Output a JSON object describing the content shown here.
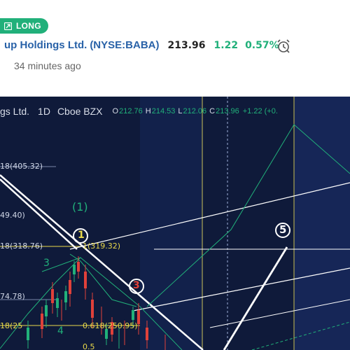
{
  "header": {
    "badge_label": "LONG",
    "company_partial": "up Holdings Ltd.",
    "ticker": "(NYSE:BABA)",
    "price": "213.96",
    "change": "1.22",
    "change_pct": "0.57%",
    "time_ago": "34 minutes ago"
  },
  "chart": {
    "symbol_partial": "gs Ltd.",
    "timeframe": "1D",
    "exchange": "Cboe BZX",
    "ohlc": [
      {
        "k": "O",
        "v": "212.76"
      },
      {
        "k": "H",
        "v": "214.53"
      },
      {
        "k": "L",
        "v": "212.06"
      },
      {
        "k": "C",
        "v": "213.96"
      },
      {
        "k": "",
        "v": "+1.22 (+0."
      }
    ],
    "fib_labels": {
      "l1": "18(405.32)",
      "l2": "49.40)",
      "l3": "18(318.76)",
      "l4": "74.78)",
      "l5": "18(25",
      "p1": "1(319.32)",
      "p2": "0.618(250.95)",
      "p3": "0.5"
    },
    "wave_labels": {
      "w1_green": "(1)",
      "w1_circle": "1",
      "w3_circle": "3",
      "w5_circle": "5",
      "g3": "3",
      "g4": "4"
    },
    "colors": {
      "background": "#0f1a3a",
      "green": "#21b07a",
      "yellow": "#e8d84a",
      "red": "#e0413a",
      "white": "#ffffff"
    }
  }
}
